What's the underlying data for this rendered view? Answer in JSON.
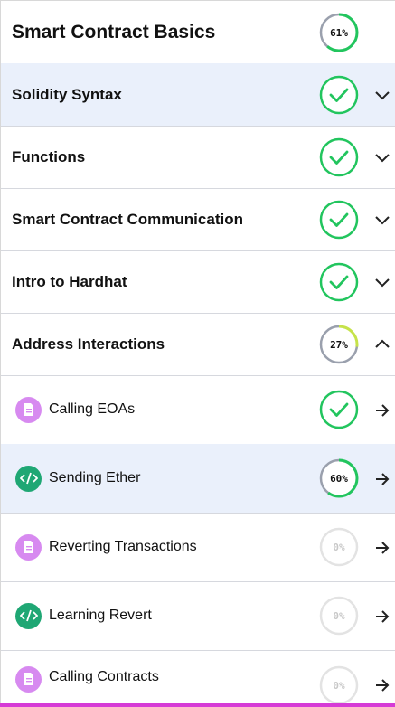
{
  "course": {
    "title": "Smart Contract Basics",
    "progress": 61
  },
  "sections": [
    {
      "label": "Solidity Syntax",
      "status": "complete",
      "expanded": false
    },
    {
      "label": "Functions",
      "status": "complete",
      "expanded": false
    },
    {
      "label": "Smart Contract Communication",
      "status": "complete",
      "expanded": false
    },
    {
      "label": "Intro to Hardhat",
      "status": "complete",
      "expanded": false
    },
    {
      "label": "Address Interactions",
      "status": "progress",
      "progress": 27,
      "expanded": true
    }
  ],
  "lessons": [
    {
      "label": "Calling EOAs",
      "type": "document",
      "status": "complete"
    },
    {
      "label": "Sending Ether",
      "type": "code",
      "status": "progress",
      "progress": 60
    },
    {
      "label": "Reverting Transactions",
      "type": "document",
      "status": "progress",
      "progress": 0
    },
    {
      "label": "Learning Revert",
      "type": "code",
      "status": "progress",
      "progress": 0
    },
    {
      "label": "Calling Contracts",
      "type": "document",
      "status": "progress",
      "progress": 0
    }
  ],
  "colors": {
    "complete": "#22c55e",
    "progress_low": "#c6e34a",
    "progress_high": "#22c55e",
    "track": "#9aa0ad",
    "track_empty": "#e3e3e3",
    "accent_bar": "#d63ad6"
  }
}
